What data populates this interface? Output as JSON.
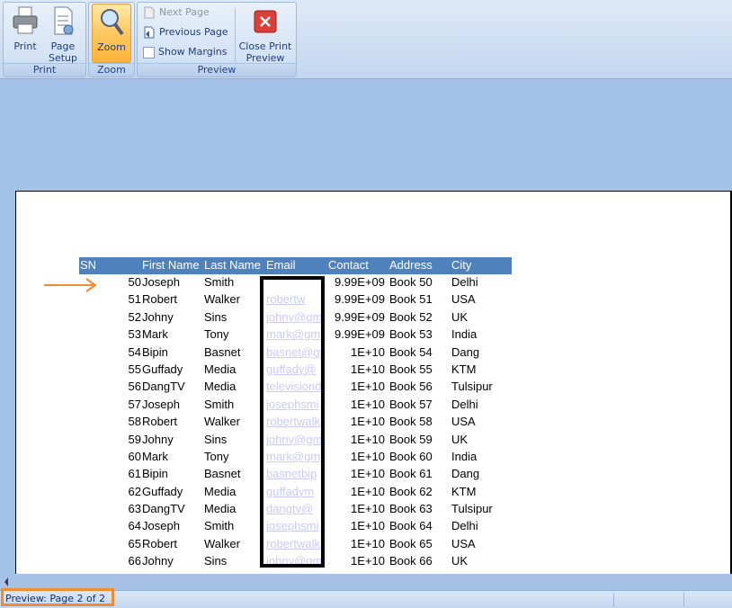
{
  "ribbon": {
    "print_group": {
      "label": "Print",
      "print_button": "Print",
      "page_setup_line1": "Page",
      "page_setup_line2": "Setup"
    },
    "zoom_group": {
      "label": "Zoom",
      "zoom_button": "Zoom"
    },
    "preview_group": {
      "label": "Preview",
      "next_page": "Next Page",
      "previous_page": "Previous Page",
      "show_margins": "Show Margins",
      "close_line1": "Close Print",
      "close_line2": "Preview"
    }
  },
  "table": {
    "headers": [
      "SN",
      "First Name",
      "Last Name",
      "Email",
      "Contact",
      "Address",
      "City"
    ],
    "rows": [
      {
        "sn": "50",
        "first": "Joseph",
        "last": "Smith",
        "email": "",
        "contact": "9.99E+09",
        "address": "Book 50",
        "city": "Delhi"
      },
      {
        "sn": "51",
        "first": "Robert",
        "last": "Walker",
        "email": "robertw",
        "contact": "9.99E+09",
        "address": "Book 51",
        "city": "USA"
      },
      {
        "sn": "52",
        "first": "Johny",
        "last": "Sins",
        "email": "johny@gm",
        "contact": "9.99E+09",
        "address": "Book 52",
        "city": "UK"
      },
      {
        "sn": "53",
        "first": "Mark",
        "last": "Tony",
        "email": "mark@gm",
        "contact": "9.99E+09",
        "address": "Book 53",
        "city": "India"
      },
      {
        "sn": "54",
        "first": "Bipin",
        "last": "Basnet",
        "email": "basnet@gm",
        "contact": "1E+10",
        "address": "Book 54",
        "city": "Dang"
      },
      {
        "sn": "55",
        "first": "Guffady",
        "last": "Media",
        "email": "guffady@",
        "contact": "1E+10",
        "address": "Book 55",
        "city": "KTM"
      },
      {
        "sn": "56",
        "first": "DangTV",
        "last": "Media",
        "email": "televisiond",
        "contact": "1E+10",
        "address": "Book 56",
        "city": "Tulsipur"
      },
      {
        "sn": "57",
        "first": "Joseph",
        "last": "Smith",
        "email": "josephsmi",
        "contact": "1E+10",
        "address": "Book 57",
        "city": "Delhi"
      },
      {
        "sn": "58",
        "first": "Robert",
        "last": "Walker",
        "email": "robertwalk",
        "contact": "1E+10",
        "address": "Book 58",
        "city": "USA"
      },
      {
        "sn": "59",
        "first": "Johny",
        "last": "Sins",
        "email": "johny@gm",
        "contact": "1E+10",
        "address": "Book 59",
        "city": "UK"
      },
      {
        "sn": "60",
        "first": "Mark",
        "last": "Tony",
        "email": "mark@gm",
        "contact": "1E+10",
        "address": "Book 60",
        "city": "India"
      },
      {
        "sn": "61",
        "first": "Bipin",
        "last": "Basnet",
        "email": "basnetbip",
        "contact": "1E+10",
        "address": "Book 61",
        "city": "Dang"
      },
      {
        "sn": "62",
        "first": "Guffady",
        "last": "Media",
        "email": "guffadym",
        "contact": "1E+10",
        "address": "Book 62",
        "city": "KTM"
      },
      {
        "sn": "63",
        "first": "DangTV",
        "last": "Media",
        "email": "dangtv@",
        "contact": "1E+10",
        "address": "Book 63",
        "city": "Tulsipur"
      },
      {
        "sn": "64",
        "first": "Joseph",
        "last": "Smith",
        "email": "josephsmi",
        "contact": "1E+10",
        "address": "Book 64",
        "city": "Delhi"
      },
      {
        "sn": "65",
        "first": "Robert",
        "last": "Walker",
        "email": "robertwalk",
        "contact": "1E+10",
        "address": "Book 65",
        "city": "USA"
      },
      {
        "sn": "66",
        "first": "Johny",
        "last": "Sins",
        "email": "johny@gm",
        "contact": "1E+10",
        "address": "Book 66",
        "city": "UK"
      }
    ]
  },
  "status": {
    "text": "Preview: Page 2 of 2"
  },
  "colors": {
    "header_bg": "#4f81bd",
    "highlight_orange": "#f28b30",
    "workspace_bg": "#a4c2e8"
  }
}
